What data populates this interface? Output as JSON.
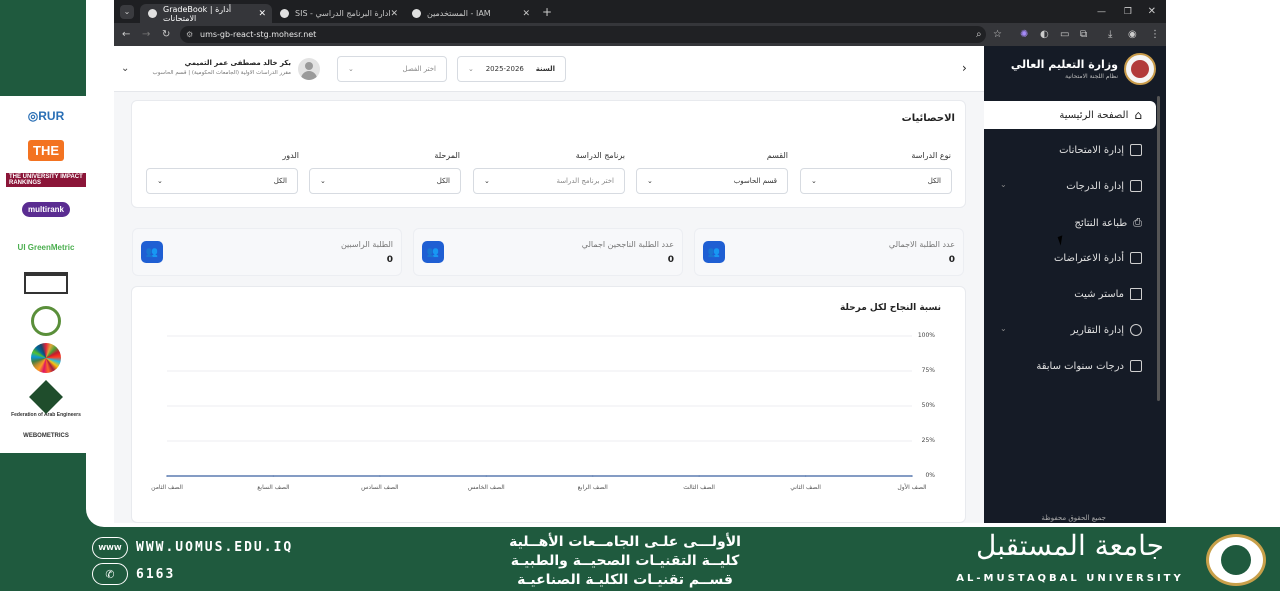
{
  "browser": {
    "tabs": [
      {
        "label": "GradeBook | أدارة الامتحانات"
      },
      {
        "label": "SIS - ادارة البرنامج الدراسي"
      },
      {
        "label": "المستخدمين - IAM"
      }
    ],
    "url": "ums-gb-react-stg.mohesr.net"
  },
  "header": {
    "user_name": "بكر خالد مصطفى عمر التميمي",
    "user_role": "مقرر الدراسات الاولية (الجامعات الحكومية) | قسم الحاسوب",
    "semester_placeholder": "اختر الفصل",
    "year_label": "السنة",
    "year_value": "2025-2026"
  },
  "sidebar": {
    "ministry": "وزارة التعليم العالي",
    "system": "نظام اللجنة الامتحانية",
    "items": [
      {
        "label": "الصفحة الرئيسية",
        "icon": "home-icon"
      },
      {
        "label": "إدارة الامتحانات",
        "icon": "list-icon"
      },
      {
        "label": "إدارة الدرجات",
        "icon": "calculator-icon"
      },
      {
        "label": "طباعة النتائج",
        "icon": "printer-icon"
      },
      {
        "label": "أدارة الاعتراضات",
        "icon": "calendar-icon"
      },
      {
        "label": "ماستر شيت",
        "icon": "folder-icon"
      },
      {
        "label": "إدارة التقارير",
        "icon": "clock-icon"
      },
      {
        "label": "درجات سنوات سابقة",
        "icon": "check-square-icon"
      }
    ],
    "footer": "جميع الحقوق محفوظة"
  },
  "stats": {
    "title": "الاحصائيات",
    "filters": [
      {
        "label": "نوع الدراسة",
        "value": "الكل"
      },
      {
        "label": "القسم",
        "value": "قسم الحاسوب"
      },
      {
        "label": "برنامج الدراسة",
        "value": "اختر برنامج الدراسة"
      },
      {
        "label": "المرحلة",
        "value": "الكل"
      },
      {
        "label": "الدور",
        "value": "الكل"
      }
    ],
    "cards": [
      {
        "title": "عدد الطلبة الاجمالي",
        "value": "0"
      },
      {
        "title": "عدد الطلبة الناجحين اجمالي",
        "value": "0"
      },
      {
        "title": "الطلبة الراسبين",
        "value": "0"
      }
    ]
  },
  "chart_data": {
    "type": "line",
    "title": "نسبة النجاح لكل مرحلة",
    "categories": [
      "الصف الأول",
      "الصف الثاني",
      "الصف الثالث",
      "الصف الرابع",
      "الصف الخامس",
      "الصف السادس",
      "الصف السابع",
      "الصف الثامن"
    ],
    "y_ticks": [
      "100%",
      "75%",
      "50%",
      "25%",
      "0%"
    ],
    "ylim": [
      0,
      100
    ],
    "series": [
      {
        "values": [
          0,
          0,
          0,
          0,
          0,
          0,
          0,
          0
        ],
        "color": "#5b7bb0"
      }
    ]
  },
  "left_logos": [
    "RUR",
    "THE",
    "THE UNIVERSITY IMPACT RANKINGS",
    "multirank",
    "UI GreenMetric",
    "SDG",
    "Federation of Arab Engineers",
    "WEBOMETRICS"
  ],
  "banner": {
    "website": "WWW.UOMUS.EDU.IQ",
    "phone": "6163",
    "line1": "الأولـــى علـى الجامــعات الأهــلية",
    "line2": "كليــة التقنيـات الصحيــة والطبيـة",
    "line3": "قســم تقنيـات الكليـة الصناعيـة",
    "univ_ar": "جامعة المستقبل",
    "univ_en": "AL-MUSTAQBAL UNIVERSITY"
  }
}
